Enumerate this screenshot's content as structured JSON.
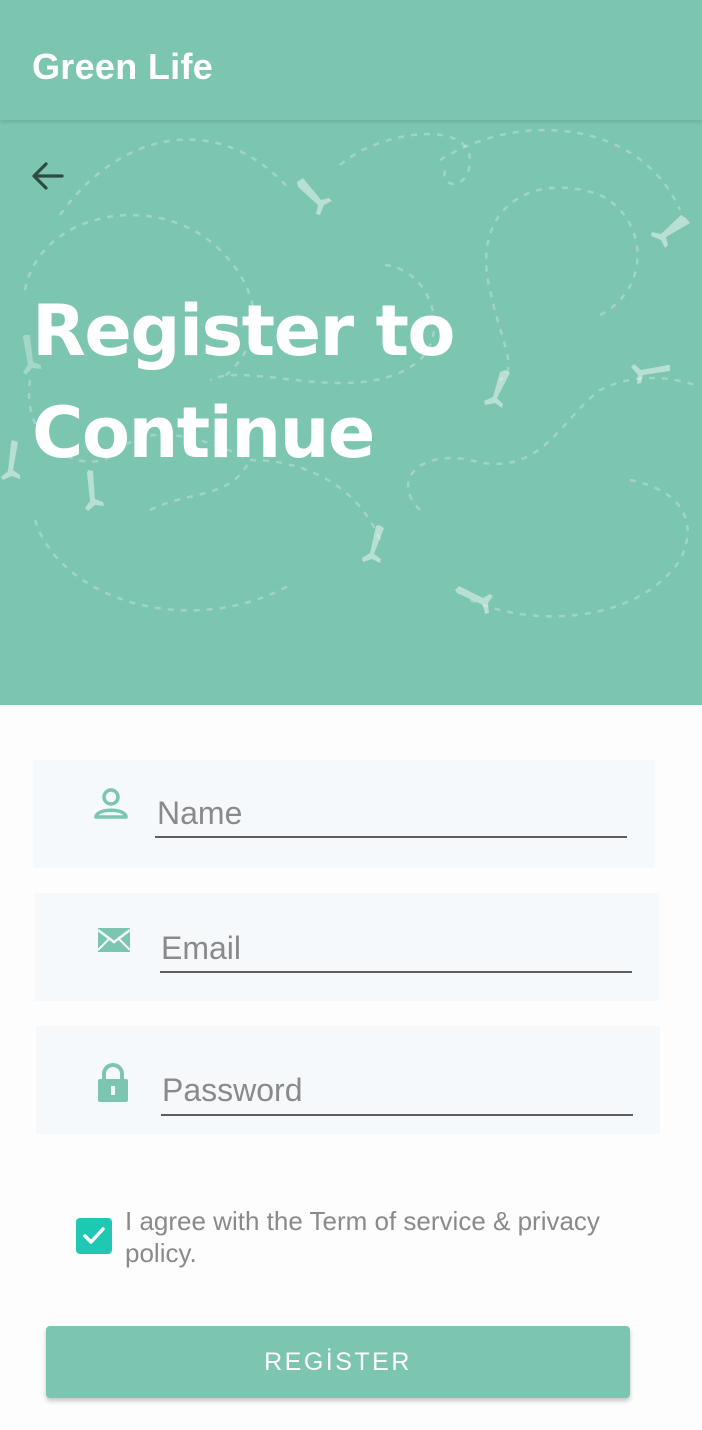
{
  "appbar": {
    "title": "Green Life"
  },
  "hero": {
    "title_line1": "Register to",
    "title_line2": "Continue"
  },
  "form": {
    "name": {
      "placeholder": "Name",
      "value": ""
    },
    "email": {
      "placeholder": "Email",
      "value": ""
    },
    "password": {
      "placeholder": "Password",
      "value": ""
    },
    "agree": {
      "checked": true,
      "label": "I agree with the Term of service & privacy policy."
    },
    "register_label": "REGİSTER"
  },
  "icons": {
    "back": "arrow-left-icon",
    "name": "person-icon",
    "email": "envelope-icon",
    "password": "lock-icon",
    "check": "checkmark-icon"
  },
  "colors": {
    "primary": "#7cc5b0",
    "accent": "#1fc8b3",
    "field_bg": "#f5f9fc",
    "field_icon": "#7cc5b0"
  }
}
